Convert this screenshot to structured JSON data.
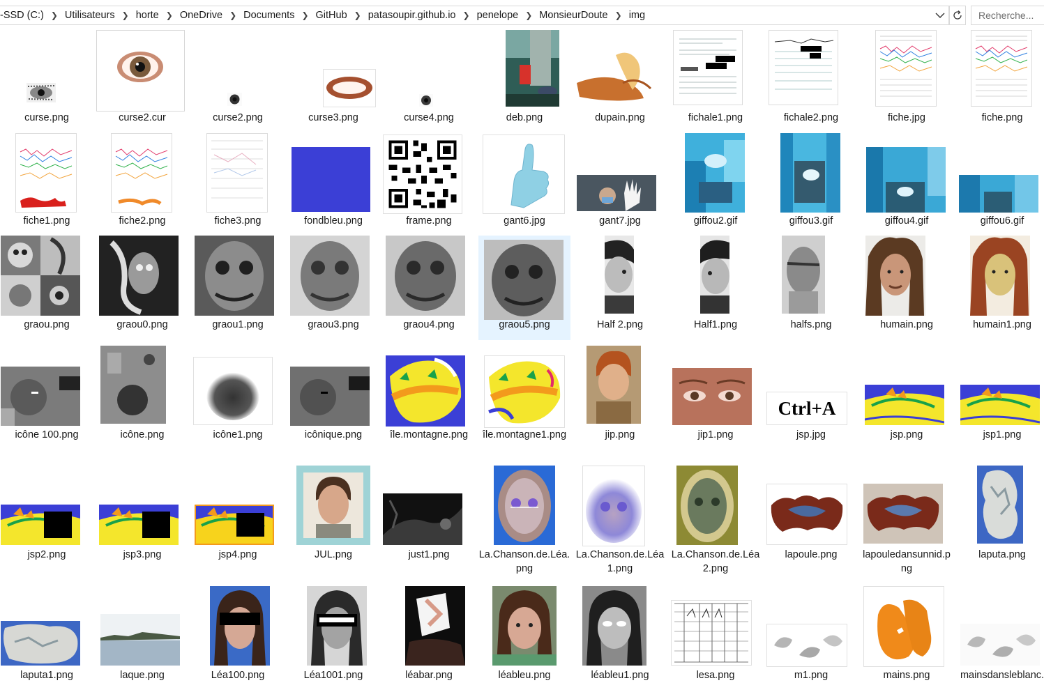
{
  "address_bar": {
    "crumbs": [
      "-SSD (C:)",
      "Utilisateurs",
      "horte",
      "OneDrive",
      "Documents",
      "GitHub",
      "patasoupir.github.io",
      "penelope",
      "MonsieurDoute",
      "img"
    ],
    "search_placeholder": "Recherche..."
  },
  "files": [
    [
      "curse.png",
      "curse2.cur",
      "curse2.png",
      "curse3.png",
      "curse4.png",
      "deb.png",
      "dupain.png",
      "fichale1.png",
      "fichale2.png",
      "fiche.jpg",
      "fiche.png"
    ],
    [
      "fiche1.png",
      "fiche2.png",
      "fiche3.png",
      "fondbleu.png",
      "frame.png",
      "gant6.jpg",
      "gant7.jpg",
      "giffou2.gif",
      "giffou3.gif",
      "giffou4.gif",
      "giffou6.gif"
    ],
    [
      "graou.png",
      "graou0.png",
      "graou1.png",
      "graou3.png",
      "graou4.png",
      "graou5.png",
      "Half 2.png",
      "Half1.png",
      "halfs.png",
      "humain.png",
      "humain1.png"
    ],
    [
      "icône 100.png",
      "icône.png",
      "icône1.png",
      "icônique.png",
      "île.montagne.png",
      "île.montagne1.png",
      "jip.png",
      "jip1.png",
      "jsp.jpg",
      "jsp.png",
      "jsp1.png"
    ],
    [
      "jsp2.png",
      "jsp3.png",
      "jsp4.png",
      "JUL.png",
      "just1.png",
      "La.Chanson.de.Léa.png",
      "La.Chanson.de.Léa1.png",
      "La.Chanson.de.Léa2.png",
      "lapoule.png",
      "lapouledansunnid.png",
      "laputa.png"
    ],
    [
      "laputa1.png",
      "laque.png",
      "Léa100.png",
      "Léa1001.png",
      "léabar.png",
      "léableu.png",
      "léableu1.png",
      "lesa.png",
      "m1.png",
      "mains.png",
      "mainsdansleblanc."
    ]
  ],
  "selected_file": "graou5.png",
  "thumbnail_text": {
    "jsp_jpg": "Ctrl+A"
  },
  "colors": {
    "selection": "#e5f3ff",
    "fondbleu": "#3b3fd6",
    "border": "#d9d9d9"
  }
}
